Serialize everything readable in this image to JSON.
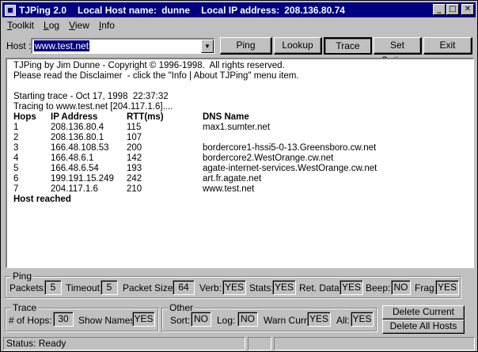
{
  "titlebar": {
    "app": "TJPing 2.0",
    "host_label": "Local Host name:",
    "host": "dunne",
    "ip_label": "Local IP address:",
    "ip": "208.136.80.74",
    "minimize": "_",
    "maximize": "□",
    "close": "✕"
  },
  "menu": [
    {
      "u": "T",
      "rest": "oolkit"
    },
    {
      "u": "L",
      "rest": "og"
    },
    {
      "u": "V",
      "rest": "iew"
    },
    {
      "u": "I",
      "rest": "nfo"
    }
  ],
  "toolbar": {
    "host_label": "Host :",
    "host_value": "www.test.net",
    "ping": "Ping",
    "lookup": "Lookup",
    "trace": "Trace",
    "set_options": "Set Options",
    "exit": "Exit"
  },
  "output": {
    "line1": "TJPing by Jim Dunne - Copyright © 1996-1998.  All rights reserved.",
    "line2": "Please read the Disclaimer  - click the \"Info | About TJPing\" menu item.",
    "line3": "Starting trace - Oct 17, 1998  22:37:32",
    "line4": "Tracing to www.test.net [204.117.1.6]....",
    "headers": [
      "Hops",
      "IP Address",
      "RTT(ms)",
      "DNS Name"
    ],
    "rows": [
      [
        "1",
        "208.136.80.4",
        "115",
        "max1.sumter.net"
      ],
      [
        "2",
        "208.136.80.1",
        "107",
        ""
      ],
      [
        "3",
        "166.48.108.53",
        "200",
        "bordercore1-hssi5-0-13.Greensboro.cw.net"
      ],
      [
        "4",
        "166.48.6.1",
        "142",
        "bordercore2.WestOrange.cw.net"
      ],
      [
        "5",
        "166.48.6.54",
        "193",
        "agate-internet-services.WestOrange.cw.net"
      ],
      [
        "6",
        "199.191.15.249",
        "242",
        "art.fr.agate.net"
      ],
      [
        "7",
        "204.117.1.6",
        "210",
        "www.test.net"
      ]
    ],
    "footer": "Host reached"
  },
  "ping": {
    "title": "Ping",
    "packets_label": "Packets:",
    "packets": "5",
    "timeout_label": "Timeout:",
    "timeout": "5",
    "size_label": "Packet Size:",
    "size": "64",
    "verb_label": "Verb:",
    "verb": "YES",
    "stats_label": "Stats:",
    "stats": "YES",
    "ret_label": "Ret. Data:",
    "ret": "YES",
    "beep_label": "Beep:",
    "beep": "NO",
    "frag_label": "Frag:",
    "frag": "YES"
  },
  "trace": {
    "title": "Trace",
    "hops_label": "# of Hops:",
    "hops": "30",
    "names_label": "Show Names:",
    "names": "YES"
  },
  "other": {
    "title": "Other",
    "sort_label": "Sort:",
    "sort": "NO",
    "log_label": "Log:",
    "log": "NO",
    "warn_label": "Warn Curr:",
    "warn": "YES",
    "all_label": "All:",
    "all": "YES"
  },
  "host_buttons": {
    "delete_current": "Delete Current Host",
    "delete_all": "Delete All Hosts"
  },
  "status": {
    "text": "Status: Ready"
  }
}
